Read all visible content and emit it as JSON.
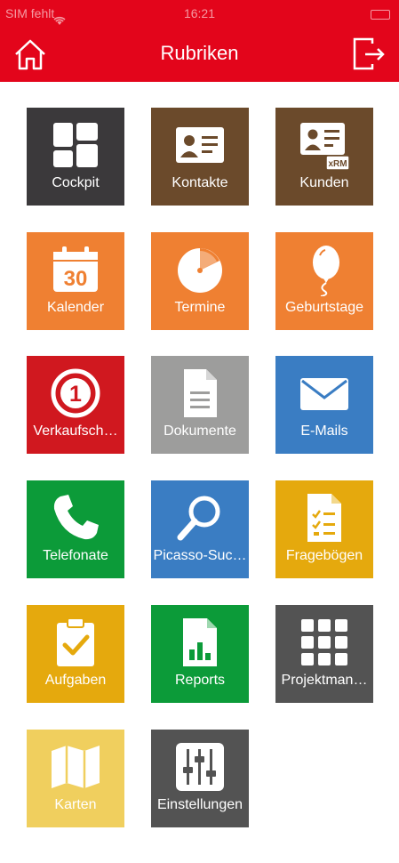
{
  "status": {
    "carrier": "SIM fehlt",
    "time": "16:21"
  },
  "header": {
    "title": "Rubriken"
  },
  "tiles": [
    {
      "label": "Cockpit",
      "color": "#3b393b",
      "icon": "cockpit-icon"
    },
    {
      "label": "Kontakte",
      "color": "#6b4a2b",
      "icon": "contact-card-icon"
    },
    {
      "label": "Kunden",
      "color": "#6b4a2b",
      "icon": "customer-card-icon",
      "badge": "xRM"
    },
    {
      "label": "Kalender",
      "color": "#ef8032",
      "icon": "calendar-icon",
      "day": "30"
    },
    {
      "label": "Termine",
      "color": "#ef8032",
      "icon": "clock-icon"
    },
    {
      "label": "Geburtstage",
      "color": "#ef8032",
      "icon": "balloon-icon"
    },
    {
      "label": "Verkaufsch…",
      "color": "#d0181f",
      "icon": "number-one-icon",
      "digit": "1"
    },
    {
      "label": "Dokumente",
      "color": "#9d9d9c",
      "icon": "document-icon"
    },
    {
      "label": "E-Mails",
      "color": "#3a7dc3",
      "icon": "envelope-icon"
    },
    {
      "label": "Telefonate",
      "color": "#0c9b39",
      "icon": "phone-icon"
    },
    {
      "label": "Picasso-Suc…",
      "color": "#3a7dc3",
      "icon": "magnifier-icon"
    },
    {
      "label": "Fragebögen",
      "color": "#e5a90d",
      "icon": "questionnaire-icon"
    },
    {
      "label": "Aufgaben",
      "color": "#e5a90d",
      "icon": "clipboard-check-icon"
    },
    {
      "label": "Reports",
      "color": "#0c9b39",
      "icon": "report-icon"
    },
    {
      "label": "Projektman…",
      "color": "#535353",
      "icon": "grid-icon"
    },
    {
      "label": "Karten",
      "color": "#f0cf5e",
      "icon": "map-icon"
    },
    {
      "label": "Einstellungen",
      "color": "#535353",
      "icon": "sliders-icon"
    }
  ]
}
